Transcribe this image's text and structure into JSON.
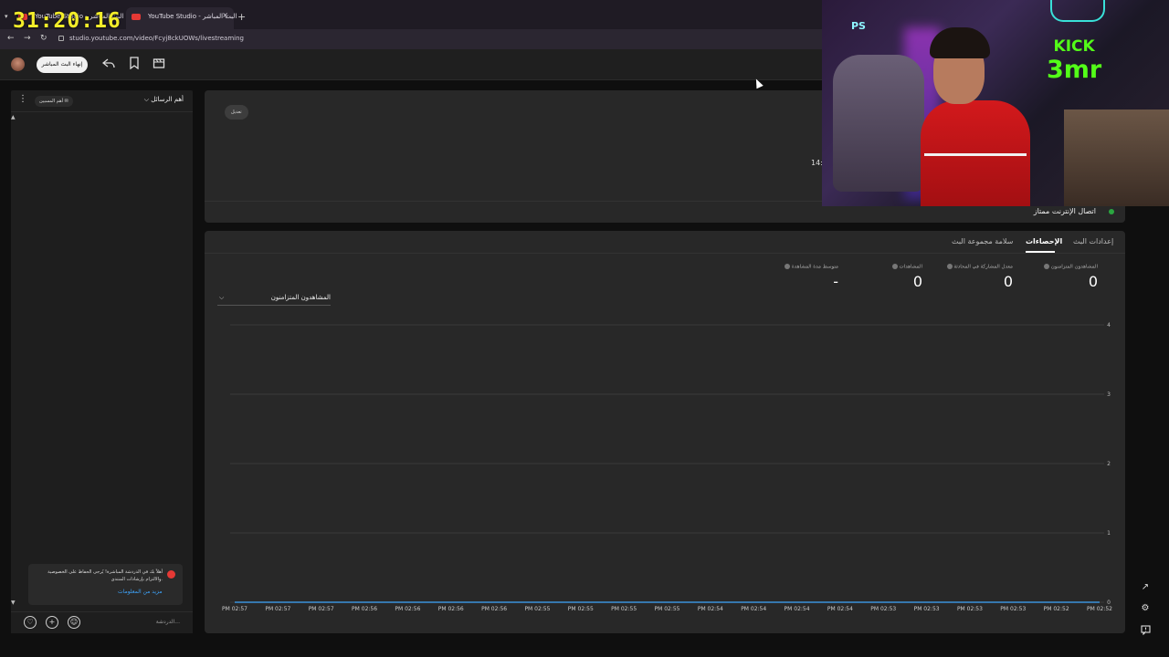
{
  "overlay": {
    "stream_timer": "31:20:16"
  },
  "browser": {
    "tabs": [
      {
        "label": "YouTube Studio - البث المباشر",
        "active": false
      },
      {
        "label": "YouTube Studio - البث المباشر",
        "active": true
      }
    ],
    "new_tab": "+",
    "url": "studio.youtube.com/video/Fcyj8ckUOWs/livestreaming"
  },
  "studio_header": {
    "end_stream_label": "إنهاء البث المباشر",
    "icons": [
      "share-icon",
      "bookmark-icon",
      "clapperboard-icon"
    ]
  },
  "chat": {
    "title": "أهم الرسائل",
    "badge": "أهم المسيين",
    "notice_text": "أهلاً بك في الدردشة المباشرة! يُرجى الحفاظ على الخصوصية والالتزام بإرشادات المنتدى.",
    "notice_link": "مزيد من المعلومات",
    "input_placeholder": "الدردشة..."
  },
  "stream_card": {
    "edit_label": "تعديل",
    "time_partial": "14:",
    "connection_status": "اتصال الإنترنت ممتاز",
    "status_color": "#2ba640"
  },
  "stats": {
    "tabs": [
      {
        "label": "إعدادات البث",
        "selected": false
      },
      {
        "label": "الإحصاءات",
        "selected": true
      },
      {
        "label": "سلامة مجموعة البث",
        "selected": false
      }
    ],
    "metrics": [
      {
        "label": "المشاهدون المتزامنون",
        "value": "0"
      },
      {
        "label": "معدل المشاركة في المحادثة",
        "value": "0"
      },
      {
        "label": "المشاهدات",
        "value": "0"
      },
      {
        "label": "متوسط مدة المشاهدة",
        "value": "-"
      }
    ],
    "graph_selector": "المشاهدون المتزامنون"
  },
  "chart_data": {
    "type": "line",
    "title": "",
    "ylabel": "",
    "xlabel": "",
    "ylim": [
      0,
      4
    ],
    "y_ticks": [
      "4",
      "3",
      "2",
      "1",
      "0"
    ],
    "x": [
      "PM 02:57",
      "PM 02:57",
      "PM 02:57",
      "PM 02:56",
      "PM 02:56",
      "PM 02:56",
      "PM 02:56",
      "PM 02:55",
      "PM 02:55",
      "PM 02:55",
      "PM 02:55",
      "PM 02:54",
      "PM 02:54",
      "PM 02:54",
      "PM 02:54",
      "PM 02:53",
      "PM 02:53",
      "PM 02:53",
      "PM 02:53",
      "PM 02:52",
      "PM 02:52"
    ],
    "series": [
      {
        "values": [
          0,
          0,
          0,
          0,
          0,
          0,
          0,
          0,
          0,
          0,
          0,
          0,
          0,
          0,
          0,
          0,
          0,
          0,
          0,
          0,
          0
        ],
        "color": "#3ea6ff"
      }
    ],
    "grid": true
  },
  "webcam": {
    "logo_top": "KICK",
    "logo_bottom": "3mr",
    "logo_color": "#53fc18",
    "ps_logo": "PS"
  },
  "right_rail_icons": [
    "open-in-new-icon",
    "settings-icon",
    "feedback-icon"
  ]
}
